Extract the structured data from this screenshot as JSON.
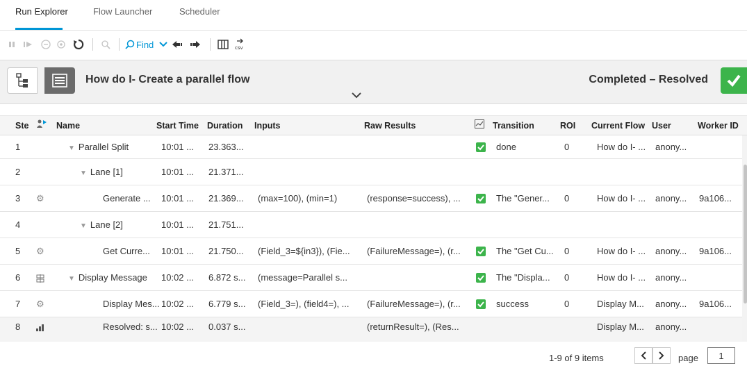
{
  "tabs": [
    {
      "label": "Run Explorer"
    },
    {
      "label": "Flow Launcher"
    },
    {
      "label": "Scheduler"
    }
  ],
  "toolbar": {
    "find_label": "Find",
    "csv_icon_text": "csv"
  },
  "header": {
    "flow_title": "How do I- Create a parallel flow",
    "status": "Completed – Resolved"
  },
  "table": {
    "columns": [
      "Ste",
      "",
      "Name",
      "Start Time",
      "Duration",
      "Inputs",
      "Raw Results",
      "",
      "Transition",
      "ROI",
      "Current Flow",
      "User",
      "Worker ID"
    ],
    "rows": [
      {
        "step": "1",
        "icon": "",
        "name": "Parallel Split",
        "start": "10:01 ...",
        "duration": "23.363...",
        "inputs": "",
        "raw": "",
        "transition": "done",
        "roi": "0",
        "flow": "How do I- ...",
        "user": "anony...",
        "worker": ""
      },
      {
        "step": "2",
        "icon": "",
        "name": "Lane [1]",
        "start": "10:01 ...",
        "duration": "21.371...",
        "inputs": "",
        "raw": "",
        "transition": "",
        "roi": "",
        "flow": "",
        "user": "",
        "worker": ""
      },
      {
        "step": "3",
        "icon": "gear-icon",
        "name": "Generate ...",
        "start": "10:01 ...",
        "duration": "21.369...",
        "inputs": "(max=100), (min=1)",
        "raw": "(response=success), ...",
        "transition": "The \"Gener...",
        "roi": "0",
        "flow": "How do I- ...",
        "user": "anony...",
        "worker": "9a106..."
      },
      {
        "step": "4",
        "icon": "",
        "name": "Lane [2]",
        "start": "10:01 ...",
        "duration": "21.751...",
        "inputs": "",
        "raw": "",
        "transition": "",
        "roi": "",
        "flow": "",
        "user": "",
        "worker": ""
      },
      {
        "step": "5",
        "icon": "gear-icon",
        "name": "Get Curre...",
        "start": "10:01 ...",
        "duration": "21.750...",
        "inputs": "(Field_3=${in3}), (Fie...",
        "raw": "(FailureMessage=), (r...",
        "transition": "The \"Get Cu...",
        "roi": "0",
        "flow": "How do I- ...",
        "user": "anony...",
        "worker": "9a106..."
      },
      {
        "step": "6",
        "icon": "subflow-icon",
        "name": "Display Message",
        "start": "10:02 ...",
        "duration": "6.872 s...",
        "inputs": "(message=Parallel s...",
        "raw": "",
        "transition": "The \"Displa...",
        "roi": "0",
        "flow": "How do I- ...",
        "user": "anony...",
        "worker": ""
      },
      {
        "step": "7",
        "icon": "gear-icon",
        "name": "Display Mes...",
        "start": "10:02 ...",
        "duration": "6.779 s...",
        "inputs": "(Field_3=), (field4=), ...",
        "raw": "(FailureMessage=), (r...",
        "transition": "success",
        "roi": "0",
        "flow": "Display M...",
        "user": "anony...",
        "worker": "9a106..."
      },
      {
        "step": "8",
        "icon": "resolved-icon",
        "name": "Resolved: s...",
        "start": "10:02 ...",
        "duration": "0.037 s...",
        "inputs": "",
        "raw": "(returnResult=), (Res...",
        "transition": "",
        "roi": "",
        "flow": "Display M...",
        "user": "anony...",
        "worker": ""
      }
    ]
  },
  "pager": {
    "info": "1-9 of 9 items",
    "page_label": "page",
    "page_value": "1"
  },
  "colors": {
    "accent": "#0096d6",
    "success": "#3cb44b"
  }
}
